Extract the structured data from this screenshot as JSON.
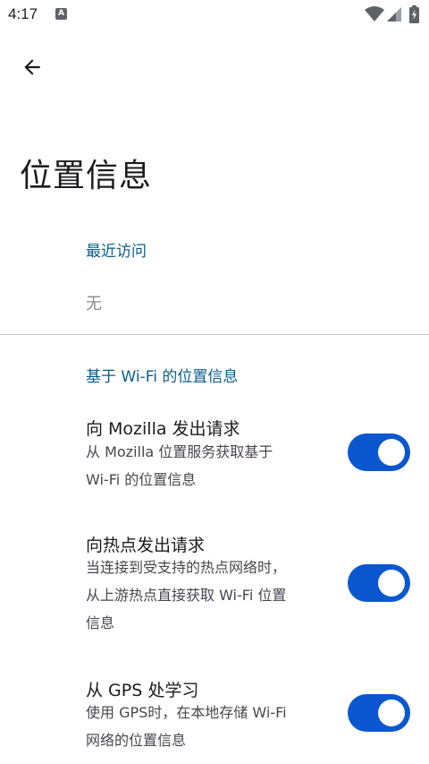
{
  "status_bar": {
    "time": "4:17",
    "notification_icon": "keyboard-a-icon",
    "notification_glyph": "A"
  },
  "header": {
    "back_icon": "arrow-back-icon"
  },
  "page": {
    "title": "位置信息"
  },
  "recent_access": {
    "header": "最近访问",
    "empty_text": "无"
  },
  "wifi_section": {
    "header": "基于 Wi-Fi 的位置信息",
    "items": [
      {
        "title": "向 Mozilla 发出请求",
        "summary_lines": [
          "从 Mozilla 位置服务获取基于",
          "Wi-Fi 的位置信息"
        ],
        "enabled": true
      },
      {
        "title": "向热点发出请求",
        "summary_lines": [
          "当连接到受支持的热点网络时，",
          "从上游热点直接获取 Wi-Fi 位置",
          "信息"
        ],
        "enabled": true
      },
      {
        "title": "从 GPS 处学习",
        "summary_lines": [
          "使用 GPS时，在本地存储 Wi-Fi",
          "网络的位置信息"
        ],
        "enabled": true
      }
    ]
  },
  "colors": {
    "accent": "#0b57d0",
    "section_header": "#0b5d8a"
  }
}
